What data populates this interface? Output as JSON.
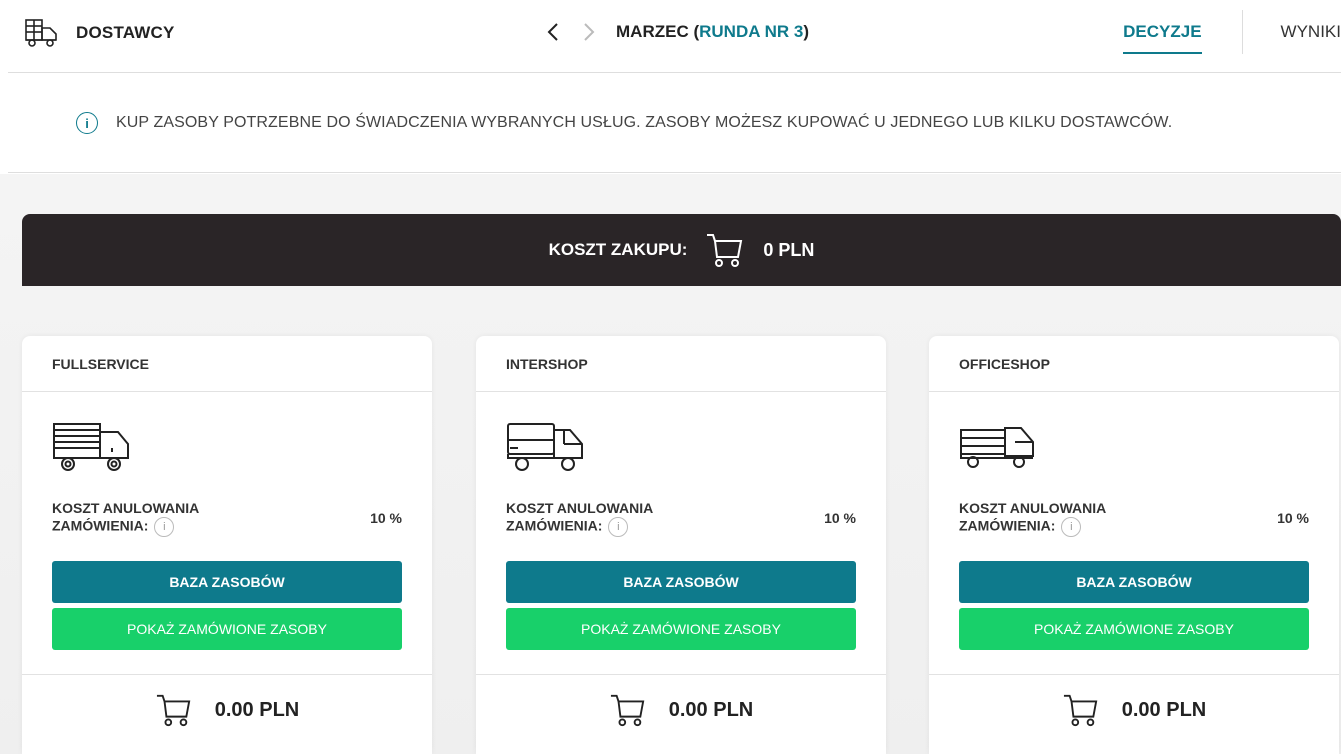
{
  "header": {
    "title": "DOSTAWCY",
    "month": "MARZEC (",
    "round": "RUNDA NR 3",
    "month_close": ")",
    "tabs": [
      {
        "label": "DECYZJE",
        "active": true
      },
      {
        "label": "WYNIKI",
        "active": false
      }
    ]
  },
  "info": {
    "text": "KUP ZASOBY POTRZEBNE DO ŚWIADCZENIA WYBRANYCH USŁUG. ZASOBY MOŻESZ KUPOWAĆ U JEDNEGO LUB KILKU DOSTAWCÓW."
  },
  "cost": {
    "label": "KOSZT ZAKUPU:",
    "value": "0 PLN"
  },
  "suppliers": [
    {
      "name": "FULLSERVICE",
      "cancel_label": "KOSZT ANULOWANIA ZAMÓWIENIA:",
      "cancel_value": "10 %",
      "base_button": "BAZA ZASOBÓW",
      "orders_button": "POKAŻ ZAMÓWIONE ZASOBY",
      "total": "0.00 PLN"
    },
    {
      "name": "INTERSHOP",
      "cancel_label": "KOSZT ANULOWANIA ZAMÓWIENIA:",
      "cancel_value": "10 %",
      "base_button": "BAZA ZASOBÓW",
      "orders_button": "POKAŻ ZAMÓWIONE ZASOBY",
      "total": "0.00 PLN"
    },
    {
      "name": "OFFICESHOP",
      "cancel_label": "KOSZT ANULOWANIA ZAMÓWIENIA:",
      "cancel_value": "10 %",
      "base_button": "BAZA ZASOBÓW",
      "orders_button": "POKAŻ ZAMÓWIONE ZASOBY",
      "total": "0.00 PLN"
    }
  ],
  "colors": {
    "accent": "#0e7a8c",
    "green": "#18d06a",
    "dark_bar": "#2a2527"
  }
}
